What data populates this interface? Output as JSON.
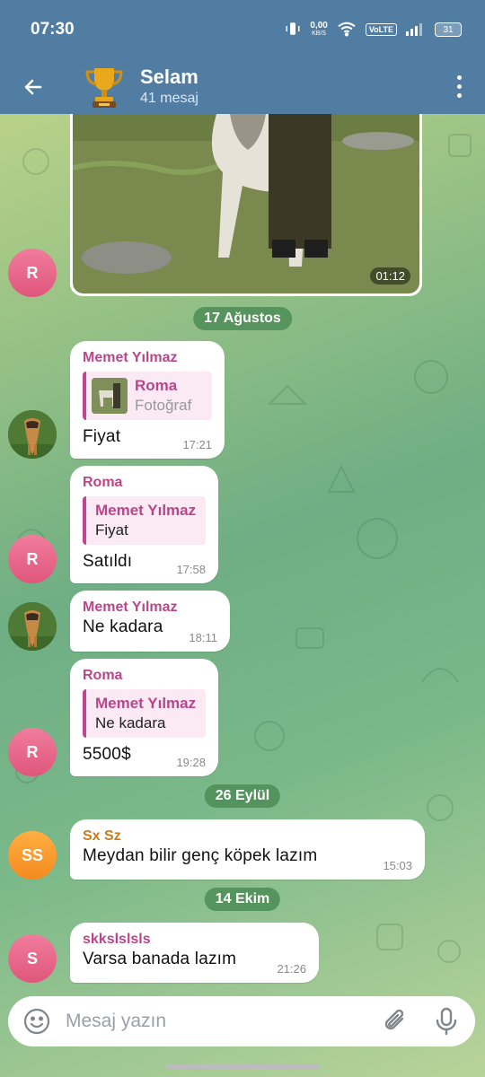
{
  "status_bar": {
    "time": "07:30",
    "speed_value": "0,00",
    "speed_unit": "KB/S",
    "network": "VoLTE",
    "battery": "31"
  },
  "header": {
    "title": "Selam",
    "subtitle": "41 mesaj"
  },
  "media": {
    "duration": "01:12"
  },
  "dates": [
    "17 Ağustos",
    "26 Eylül",
    "14 Ekim"
  ],
  "messages": [
    {
      "sender": "Memet Yılmaz",
      "reply_name": "Roma",
      "reply_text": "Fotoğraf",
      "text": "Fiyat",
      "time": "17:21"
    },
    {
      "sender": "Roma",
      "reply_name": "Memet Yılmaz",
      "reply_text": "Fiyat",
      "text": "Satıldı",
      "time": "17:58"
    },
    {
      "sender": "Memet Yılmaz",
      "text": "Ne kadara",
      "time": "18:11"
    },
    {
      "sender": "Roma",
      "reply_name": "Memet Yılmaz",
      "reply_text": "Ne kadara",
      "text": "5500$",
      "time": "19:28"
    },
    {
      "sender": "Sx Sz",
      "text": "Meydan bilir genç köpek lazım",
      "time": "15:03"
    },
    {
      "sender": "skkslslsls",
      "text": "Varsa banada lazım",
      "time": "21:26"
    }
  ],
  "avatars": {
    "roma": "R",
    "sxsz": "SS",
    "skk": "S"
  },
  "input": {
    "placeholder": "Mesaj yazın"
  },
  "colors": {
    "header": "#517da2",
    "sender_pink": "#b8478a",
    "sender_orange": "#c97a1b",
    "date_pill": "#4c8c56"
  }
}
